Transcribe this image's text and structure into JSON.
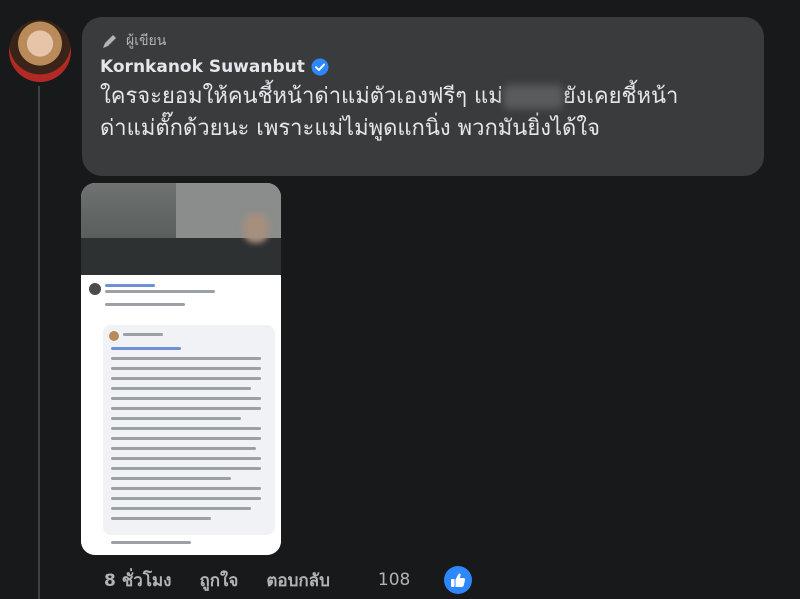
{
  "comment": {
    "role_label": "ผู้เขียน",
    "author": "Kornkanok Suwanbut",
    "text_part1": "ใครจะยอมให้คนชี้หน้าด่าแม่ตัวเองฟรีๆ แม่",
    "text_part2": "ยังเคยชี้หน้า",
    "text_line2": "ด่าแม่ตั๊กด้วยนะ เพราะแม่ไม่พูดแกนิ่ง พวกมันยิ่งได้ใจ"
  },
  "actions": {
    "time": "8 ชั่วโมง",
    "like": "ถูกใจ",
    "reply": "ตอบกลับ",
    "reaction_count": "108"
  },
  "colors": {
    "background": "#18191a",
    "bubble": "#3a3b3c",
    "verified": "#2d88ff",
    "like_badge": "#2d88ff"
  },
  "icons": [
    "pencil-icon",
    "verified-badge-icon",
    "like-thumb-icon"
  ]
}
